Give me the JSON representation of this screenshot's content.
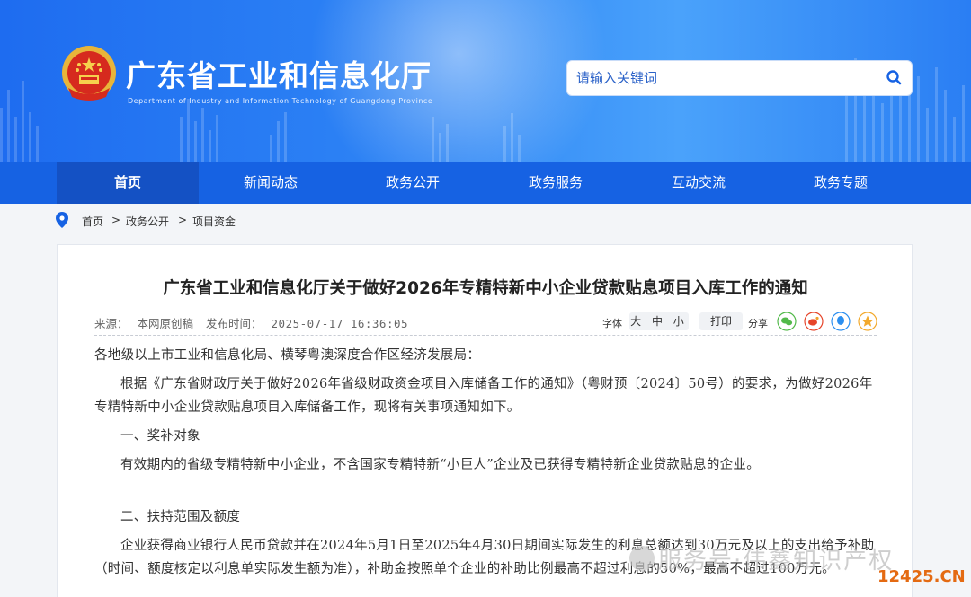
{
  "site": {
    "title": "广东省工业和信息化厅",
    "subtitle": "Department of Industry and Information Technology of Guangdong Province"
  },
  "search": {
    "placeholder": "请输入关键词"
  },
  "nav": {
    "items": [
      {
        "label": "首页",
        "active": true
      },
      {
        "label": "新闻动态"
      },
      {
        "label": "政务公开"
      },
      {
        "label": "政务服务"
      },
      {
        "label": "互动交流"
      },
      {
        "label": "政务专题"
      }
    ]
  },
  "breadcrumb": {
    "items": [
      "首页",
      "政务公开",
      "项目资金"
    ],
    "separator": ">"
  },
  "article": {
    "title": "广东省工业和信息化厅关于做好2026年专精特新中小企业贷款贴息项目入库工作的通知",
    "source_label": "来源：",
    "source": "本网原创稿",
    "time_label": "发布时间：",
    "time": "2025-07-17 16:36:05",
    "font_label": "字体",
    "font_sizes": "大 中 小",
    "print_label": "打印",
    "share_label": "分享",
    "share_icons": [
      "wechat-icon",
      "weibo-icon",
      "qq-icon",
      "qzone-icon"
    ],
    "paragraphs": [
      "各地级以上市工业和信息化局、横琴粤澳深度合作区经济发展局：",
      "根据《广东省财政厅关于做好2026年省级财政资金项目入库储备工作的通知》（粤财预〔2024〕50号）的要求，为做好2026年专精特新中小企业贷款贴息项目入库储备工作，现将有关事项通知如下。",
      "一、奖补对象",
      "有效期内的省级专精特新中小企业，不含国家专精特新“小巨人”企业及已获得专精特新企业贷款贴息的企业。",
      "二、扶持范围及额度",
      "企业获得商业银行人民币贷款并在2024年5月1日至2025年4月30日期间实际发生的利息总额达到30万元及以上的支出给予补助（时间、额度核定以利息单实际发生额为准），补助金按照单个企业的补助比例最高不超过利息的50%，最高不超过100万元。"
    ]
  },
  "watermark": {
    "text": "服务号·伟鑫知识产权",
    "domain": "12425.CN"
  },
  "colors": {
    "nav": "#1662e3",
    "nav_active": "#1451c4",
    "banner": "#2f86f5",
    "watermark_domain": "#e46a12"
  }
}
